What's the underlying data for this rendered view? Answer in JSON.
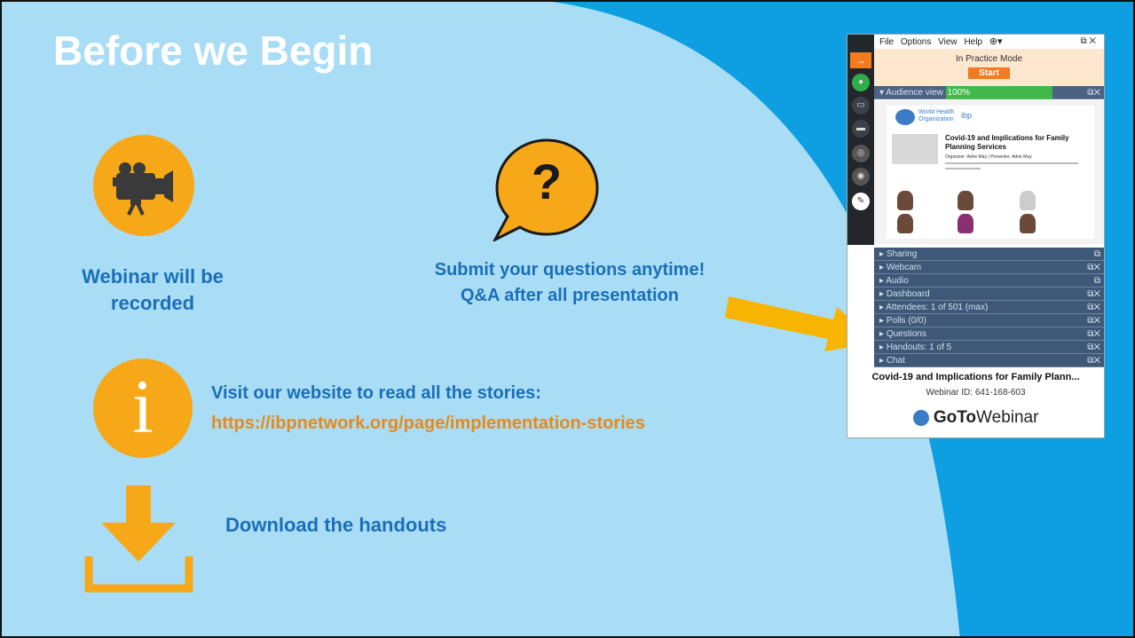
{
  "slide": {
    "title": "Before we Begin",
    "recorded": {
      "line1": "Webinar will be",
      "line2": "recorded",
      "icon": "video-camera-icon"
    },
    "questions": {
      "line1": "Submit your questions anytime!",
      "line2": "Q&A after all presentation",
      "icon": "question-bubble-icon",
      "mark": "?"
    },
    "website": {
      "line1": "Visit our website to read all the stories:",
      "url": "https://ibpnetwork.org/page/implementation-stories",
      "icon": "info-icon",
      "mark": "i"
    },
    "handouts": {
      "label": "Download the handouts",
      "icon": "download-icon"
    }
  },
  "gotowebinar": {
    "menu": [
      "File",
      "Options",
      "View",
      "Help"
    ],
    "practice_mode": "In Practice Mode",
    "start_label": "Start",
    "audience_view": "Audience view",
    "audience_zoom": "100%",
    "thumbnail": {
      "org1": "World Health Organization",
      "org2": "ibp",
      "slide_title": "Covid-19 and Implications for Family Planning Services",
      "organizer": "Organizer: Adrie May | Presenter: Adrie May"
    },
    "panels": [
      {
        "label": "Sharing"
      },
      {
        "label": "Webcam"
      },
      {
        "label": "Audio"
      },
      {
        "label": "Dashboard"
      },
      {
        "label": "Attendees:  1 of 501 (max)"
      },
      {
        "label": "Polls (0/0)"
      },
      {
        "label": "Questions"
      },
      {
        "label": "Handouts: 1 of 5"
      },
      {
        "label": "Chat"
      }
    ],
    "webinar_title": "Covid-19 and Implications for Family Plann...",
    "webinar_id": "Webinar ID: 641-168-603",
    "brand_goto": "GoTo",
    "brand_webinar": "Webinar"
  },
  "colors": {
    "accent_orange": "#f7a818",
    "text_blue": "#1b6fb8",
    "url_orange": "#e8891b",
    "bg_light": "#a9ddf5",
    "bg_dark": "#0e9ee2"
  }
}
